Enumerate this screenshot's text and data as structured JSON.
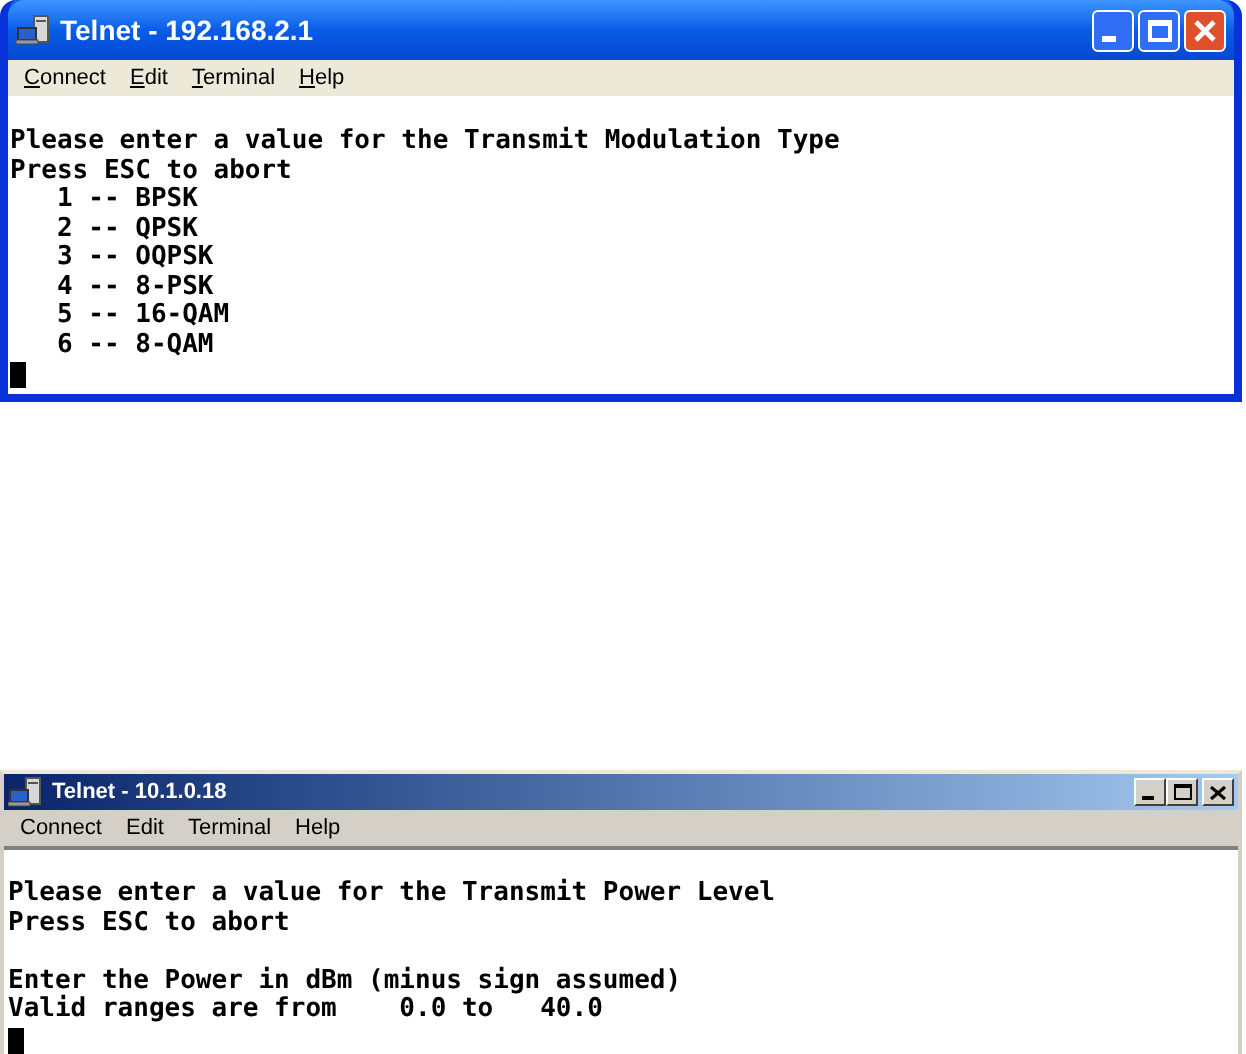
{
  "windows": [
    {
      "kind": "xp",
      "title": "Telnet - 192.168.2.1",
      "access_keys_underlined": true,
      "menu": [
        "Connect",
        "Edit",
        "Terminal",
        "Help"
      ],
      "paragraphs": [
        [
          "Please enter a value for the Transmit Modulation Type",
          "Press ESC to abort",
          "   1 -- BPSK",
          "   2 -- QPSK",
          "   3 -- OQPSK",
          "   4 -- 8-PSK",
          "   5 -- 16-QAM",
          "   6 -- 8-QAM"
        ]
      ]
    },
    {
      "kind": "classic",
      "title": "Telnet - 10.1.0.18",
      "access_keys_underlined": false,
      "menu": [
        "Connect",
        "Edit",
        "Terminal",
        "Help"
      ],
      "paragraphs": [
        [
          "Please enter a value for the Transmit Power Level",
          "Press ESC to abort"
        ],
        [
          "Enter the Power in dBm (minus sign assumed)",
          "Valid ranges are from    0.0 to   40.0"
        ]
      ]
    }
  ]
}
